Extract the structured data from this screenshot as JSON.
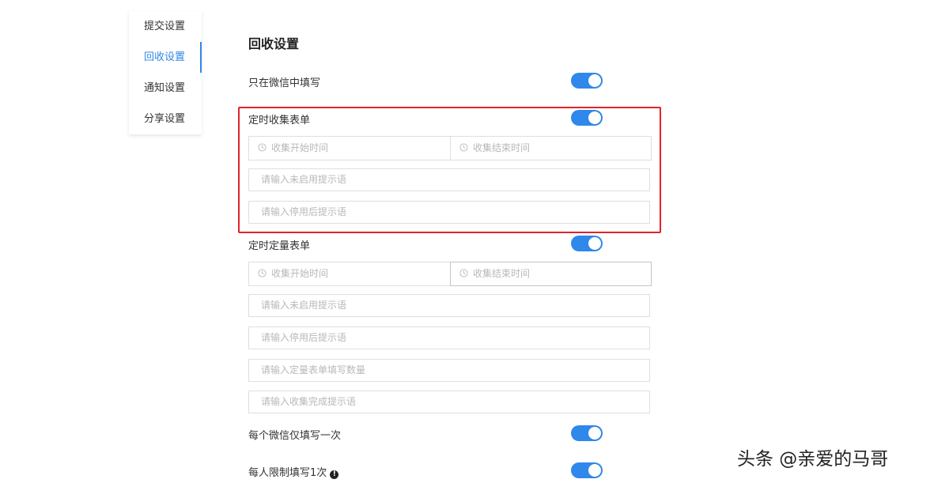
{
  "sidebar": {
    "items": [
      {
        "label": "提交设置",
        "active": false
      },
      {
        "label": "回收设置",
        "active": true
      },
      {
        "label": "通知设置",
        "active": false
      },
      {
        "label": "分享设置",
        "active": false
      }
    ]
  },
  "main": {
    "title": "回收设置",
    "wechat_only": {
      "label": "只在微信中填写",
      "enabled": true
    },
    "timed_collect": {
      "label": "定时收集表单",
      "enabled": true,
      "start_placeholder": "收集开始时间",
      "end_placeholder": "收集结束时间",
      "not_started_placeholder": "请输入未启用提示语",
      "after_stop_placeholder": "请输入停用后提示语"
    },
    "timed_quota": {
      "label": "定时定量表单",
      "enabled": true,
      "start_placeholder": "收集开始时间",
      "end_placeholder": "收集结束时间",
      "not_started_placeholder": "请输入未启用提示语",
      "after_stop_placeholder": "请输入停用后提示语",
      "quota_placeholder": "请输入定量表单填写数量",
      "complete_placeholder": "请输入收集完成提示语"
    },
    "wechat_once": {
      "label": "每个微信仅填写一次",
      "enabled": true
    },
    "person_limit": {
      "label": "每人限制填写1次",
      "enabled": true,
      "info_icon": "!"
    }
  },
  "watermark": "头条 @亲爱的马哥",
  "colors": {
    "accent": "#2f88ea",
    "highlight": "#e0242a",
    "border": "#dcdfe6",
    "placeholder": "#b8b8b8"
  }
}
